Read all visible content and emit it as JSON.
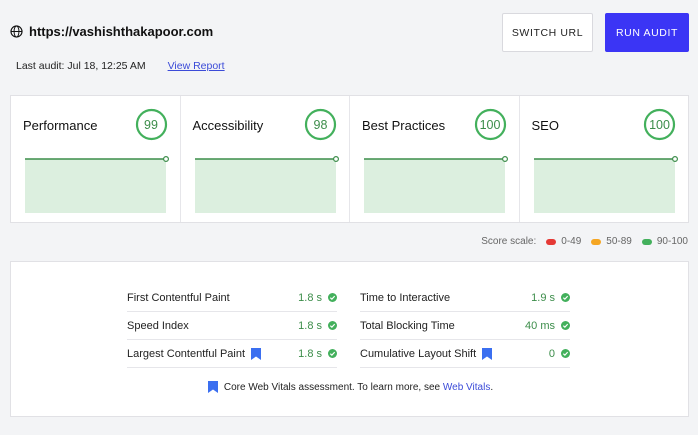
{
  "header": {
    "url": "https://vashishthakapoor.com",
    "last_audit_label": "Last audit: Jul 18, 12:25 AM",
    "view_report_label": "View Report",
    "switch_url_label": "SWITCH URL",
    "run_audit_label": "RUN AUDIT"
  },
  "categories": [
    {
      "name": "Performance",
      "score": "99",
      "trend": [
        99,
        99
      ]
    },
    {
      "name": "Accessibility",
      "score": "98",
      "trend": [
        98,
        98
      ]
    },
    {
      "name": "Best Practices",
      "score": "100",
      "trend": [
        100,
        100
      ]
    },
    {
      "name": "SEO",
      "score": "100",
      "trend": [
        100,
        100
      ]
    }
  ],
  "score_scale": {
    "label": "Score scale:",
    "ranges": [
      {
        "label": "0-49",
        "color": "#e53935"
      },
      {
        "label": "50-89",
        "color": "#f5a623"
      },
      {
        "label": "90-100",
        "color": "#43b05c"
      }
    ]
  },
  "metrics": {
    "left": [
      {
        "label": "First Contentful Paint",
        "value": "1.8 s",
        "cwv": false
      },
      {
        "label": "Speed Index",
        "value": "1.8 s",
        "cwv": false
      },
      {
        "label": "Largest Contentful Paint",
        "value": "1.8 s",
        "cwv": true
      }
    ],
    "right": [
      {
        "label": "Time to Interactive",
        "value": "1.9 s",
        "cwv": false
      },
      {
        "label": "Total Blocking Time",
        "value": "40 ms",
        "cwv": false
      },
      {
        "label": "Cumulative Layout Shift",
        "value": "0",
        "cwv": true
      }
    ],
    "footer_text": "Core Web Vitals assessment. To learn more, see",
    "footer_link": "Web Vitals",
    "footer_end": "."
  },
  "colors": {
    "good": "#3c8d4a",
    "accent": "#3b35f5",
    "link": "#3b4bd8"
  }
}
